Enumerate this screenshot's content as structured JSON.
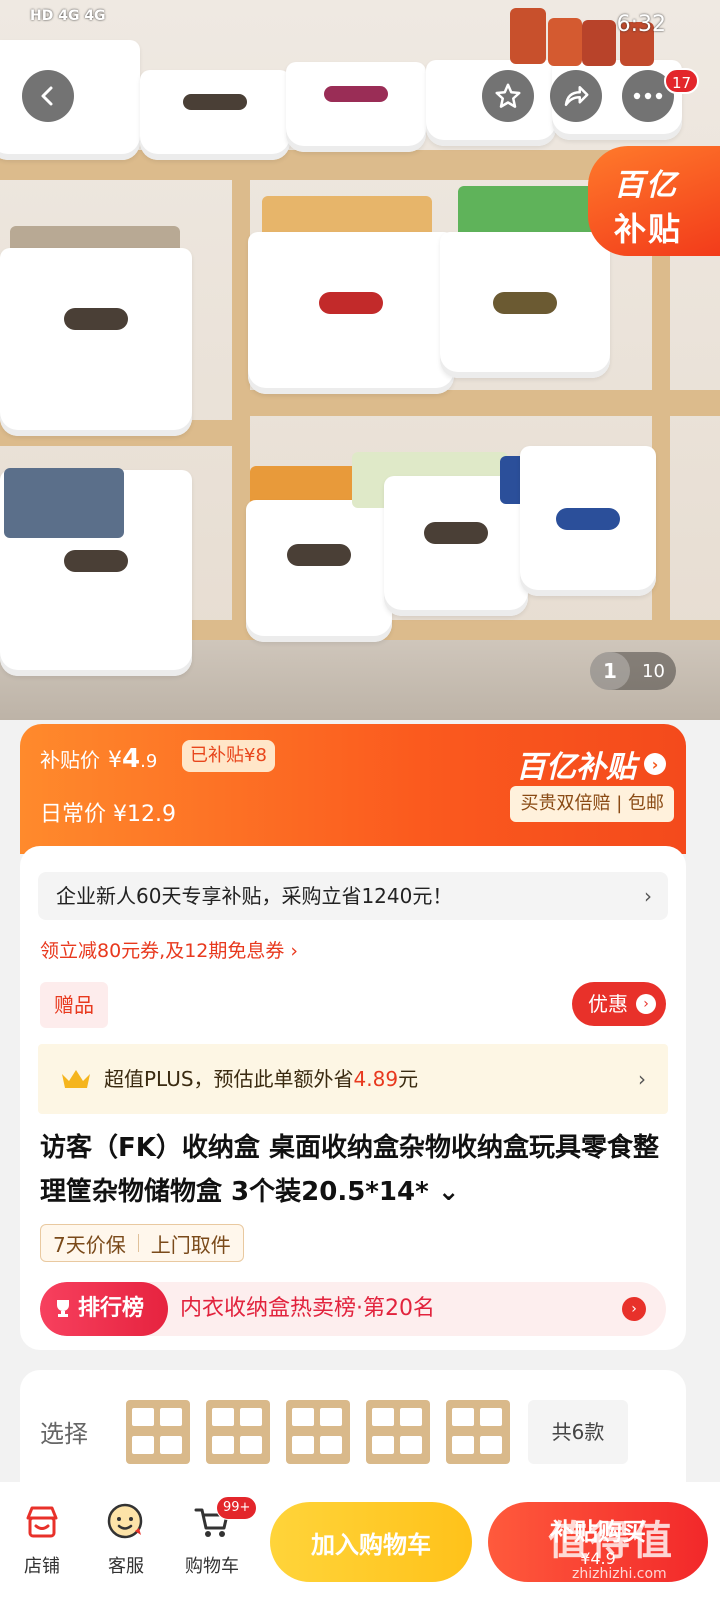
{
  "status_bar": {
    "left_text": "HD 4G 4G",
    "time": "6:32"
  },
  "hero": {
    "subsidy_corner_line1": "百亿",
    "subsidy_corner_line2": "补贴",
    "image_index": "1",
    "image_total": "10",
    "cart_count_badge": "17"
  },
  "price_card": {
    "subsidy_label": "补贴价",
    "currency": "¥",
    "price_int": "4",
    "price_dec": ".9",
    "subsidized_chip": "已补贴¥8",
    "daily_price_label": "日常价",
    "daily_price": "¥12.9",
    "brand": "百亿补贴",
    "guarantee": "买贵双倍赔 | 包邮"
  },
  "details": {
    "new_user_promo": "企业新人60天专享补贴，采购立省1240元！",
    "coupon_text": "领立减80元券,及12期免息券 ›",
    "gift_label": "赠品",
    "discount_button": "优惠",
    "plus_prefix": "超值PLUS，预估此单额外省",
    "plus_amount": "4.89",
    "plus_suffix": "元",
    "title": "访客（FK）收纳盒 桌面收纳盒杂物收纳盒玩具零食整理筐杂物储物盒 3个装20.5*14* ⌄",
    "tag1": "7天价保",
    "tag2": "上门取件",
    "rank_label": "排行榜",
    "rank_text": "内衣收纳盒热卖榜·第20名"
  },
  "select": {
    "label": "选择",
    "total": "共6款"
  },
  "bottom_bar": {
    "shop": "店铺",
    "service": "客服",
    "cart": "购物车",
    "cart_badge": "99+",
    "add_to_cart": "加入购物车",
    "buy_now": "补贴购买",
    "buy_price": "¥4.9"
  },
  "watermark": {
    "main": "值得值",
    "sub": "zhizhizhi.com"
  },
  "colors": {
    "accent_orange": "#fb5a1e",
    "accent_red": "#e8312a",
    "cart_yellow": "#ffc21a"
  },
  "icons": [
    "back-icon",
    "star-icon",
    "share-icon",
    "more-icon",
    "shop-icon",
    "service-icon",
    "cart-icon",
    "crown-icon",
    "trophy-icon"
  ]
}
